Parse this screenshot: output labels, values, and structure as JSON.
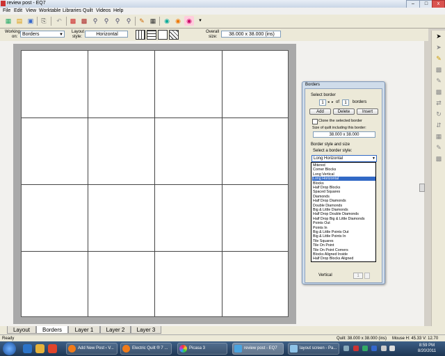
{
  "window": {
    "title": "review post - EQ7"
  },
  "menu": [
    "File",
    "Edit",
    "View",
    "Worktable",
    "Libraries",
    "Quilt",
    "Videos",
    "Help"
  ],
  "props": {
    "working_on_label_1": "Working",
    "working_on_label_2": "on:",
    "working_on_value": "Borders",
    "layout_style_label_1": "Layout",
    "layout_style_label_2": "style:",
    "layout_style_value": "Horizontal",
    "overall_size_label_1": "Overall",
    "overall_size_label_2": "size:",
    "overall_size_value": "38.000 x 38.000 (ins)"
  },
  "tabs": [
    "Layout",
    "Borders",
    "Layer 1",
    "Layer 2",
    "Layer 3"
  ],
  "status": {
    "left": "Ready",
    "quilt": "Quilt: 38.000 x 38.000 (ins)",
    "mouse": "Mouse  H: 45.33   V: 12.70"
  },
  "taskbar": {
    "items": [
      "Add New Post ‹ V...",
      "Electric Quilt ® 7 ...",
      "Picasa 3",
      "review post - EQ7",
      "layout screen - Pa..."
    ],
    "time": "8:59 PM",
    "date": "8/20/2011"
  },
  "dialog": {
    "title": "Borders",
    "select_border": "Select border",
    "border_index": "1",
    "of": "of",
    "border_total": "1",
    "borders": "borders",
    "add": "Add",
    "delete": "Delete",
    "insert": "Insert",
    "clone_label": "Clone the selected border",
    "size_label": "Size of quilt including this border:",
    "size_value": "38.000 x 38.000",
    "style_section": "Border style and size",
    "select_style": "Select a border style:",
    "selected_style": "Long Horizontal",
    "vertical_label": "Vertical",
    "vertical_value": "1",
    "options": [
      "Mitered",
      "Corner Blocks",
      "Long Vertical",
      "Long Horizontal",
      "Blocks",
      "Half Drop Blocks",
      "Spaced Squares",
      "Diamonds",
      "Half Drop Diamonds",
      "Double Diamonds",
      "Big & Little Diamonds",
      "Half Drop Double Diamonds",
      "Half Drop Big & Little Diamonds",
      "Points Out",
      "Points In",
      "Big & Little Points Out",
      "Big & Little Points In",
      "Tile Squares",
      "Tile On Point",
      "Tile On Point Corners",
      "Blocks Aligned Inside",
      "Half Drop Blocks Aligned"
    ],
    "selected_index": 3
  },
  "colors": {
    "selection": "#3169c6",
    "taskbar": "#2a4a70",
    "workspace": "#f2f1ee"
  }
}
